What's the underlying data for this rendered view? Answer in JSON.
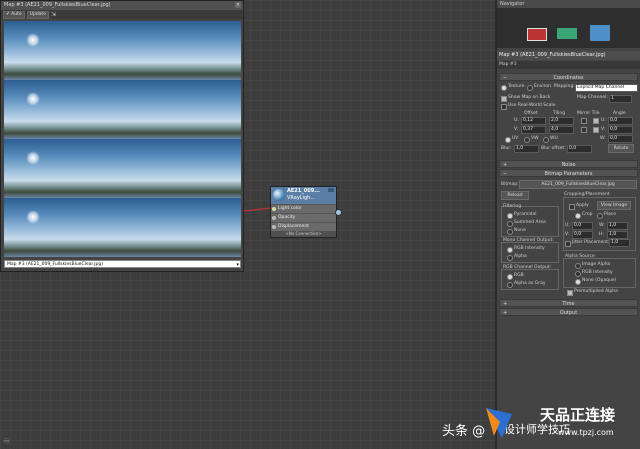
{
  "preview": {
    "title": "Map #3 (AE21_009_FullskiesBlueClear.jpg)",
    "auto_label": "Auto",
    "update_label": "Update",
    "dropdown_value": "Map #3 (AE21_009_FullskiesBlueClear.jpg)"
  },
  "node": {
    "name": "AE21_009...",
    "type": "VRayLigh...",
    "slots": [
      "Light color",
      "Opacity",
      "Displacement"
    ],
    "footer": "<No Connection>"
  },
  "navigator": {
    "title": "Navigator"
  },
  "material": {
    "title": "Map #3 (AE21_009_FullskiesBlueClear.jpg)",
    "name": "Map #3"
  },
  "coordinates": {
    "header": "Coordinates",
    "texture_label": "Texture",
    "environ_label": "Environ",
    "mapping_label": "Mapping:",
    "mapping_value": "Explicit Map Channel",
    "show_map_label": "Show Map on Back",
    "map_channel_label": "Map Channel:",
    "map_channel_value": "1",
    "real_world_label": "Use Real-World Scale",
    "col_offset": "Offset",
    "col_tiling": "Tiling",
    "col_mirror_tile": "Mirror Tile",
    "col_angle": "Angle",
    "u_label": "U:",
    "v_label": "V:",
    "w_label": "W:",
    "u_offset": "0,12",
    "u_tiling": "2,0",
    "u_angle": "0,0",
    "v_offset": "0,37",
    "v_tiling": "4,0",
    "v_angle": "0,0",
    "w_angle": "0,0",
    "uv_label": "UV",
    "vw_label": "VW",
    "wu_label": "WU",
    "blur_label": "Blur:",
    "blur_value": "1,0",
    "blur_offset_label": "Blur offset:",
    "blur_offset_value": "0,0",
    "rotate_label": "Rotate"
  },
  "noise": {
    "header": "Noise"
  },
  "bitmap": {
    "header": "Bitmap Parameters",
    "bitmap_label": "Bitmap:",
    "bitmap_value": "AE21_009_FullskiesBlueClear.jpg",
    "reload_label": "Reload",
    "cropping_title": "Cropping/Placement",
    "apply_label": "Apply",
    "view_image_label": "View Image",
    "crop_label": "Crop",
    "place_label": "Place",
    "u_label": "U:",
    "v_label": "V:",
    "w_label": "W:",
    "h_label": "H:",
    "u_value": "0,0",
    "v_value": "0,0",
    "w_value": "1,0",
    "h_value": "1,0",
    "jitter_label": "Jitter Placement:",
    "jitter_value": "1,0",
    "filtering_title": "Filtering",
    "pyramidal": "Pyramidal",
    "summed_area": "Summed Area",
    "none": "None",
    "mono_title": "Mono Channel Output:",
    "rgb_intensity": "RGB Intensity",
    "alpha": "Alpha",
    "rgb_out_title": "RGB Channel Output:",
    "rgb": "RGB",
    "alpha_as_gray": "Alpha as Gray",
    "alpha_source_title": "Alpha Source",
    "image_alpha": "Image Alpha",
    "rgb_intensity2": "RGB Intensity",
    "none_opaque": "None (Opaque)",
    "premultiplied": "Premultiplied Alpha"
  },
  "time": {
    "header": "Time"
  },
  "output": {
    "header": "Output"
  },
  "watermark": {
    "left_text": "头条 @",
    "left_text2": "设计师学技巧",
    "brand_cn": "天品正连接",
    "brand_url": "www.tpzj.com"
  },
  "colors": {
    "accent": "#5a7ea5",
    "wire": "#c03030"
  }
}
